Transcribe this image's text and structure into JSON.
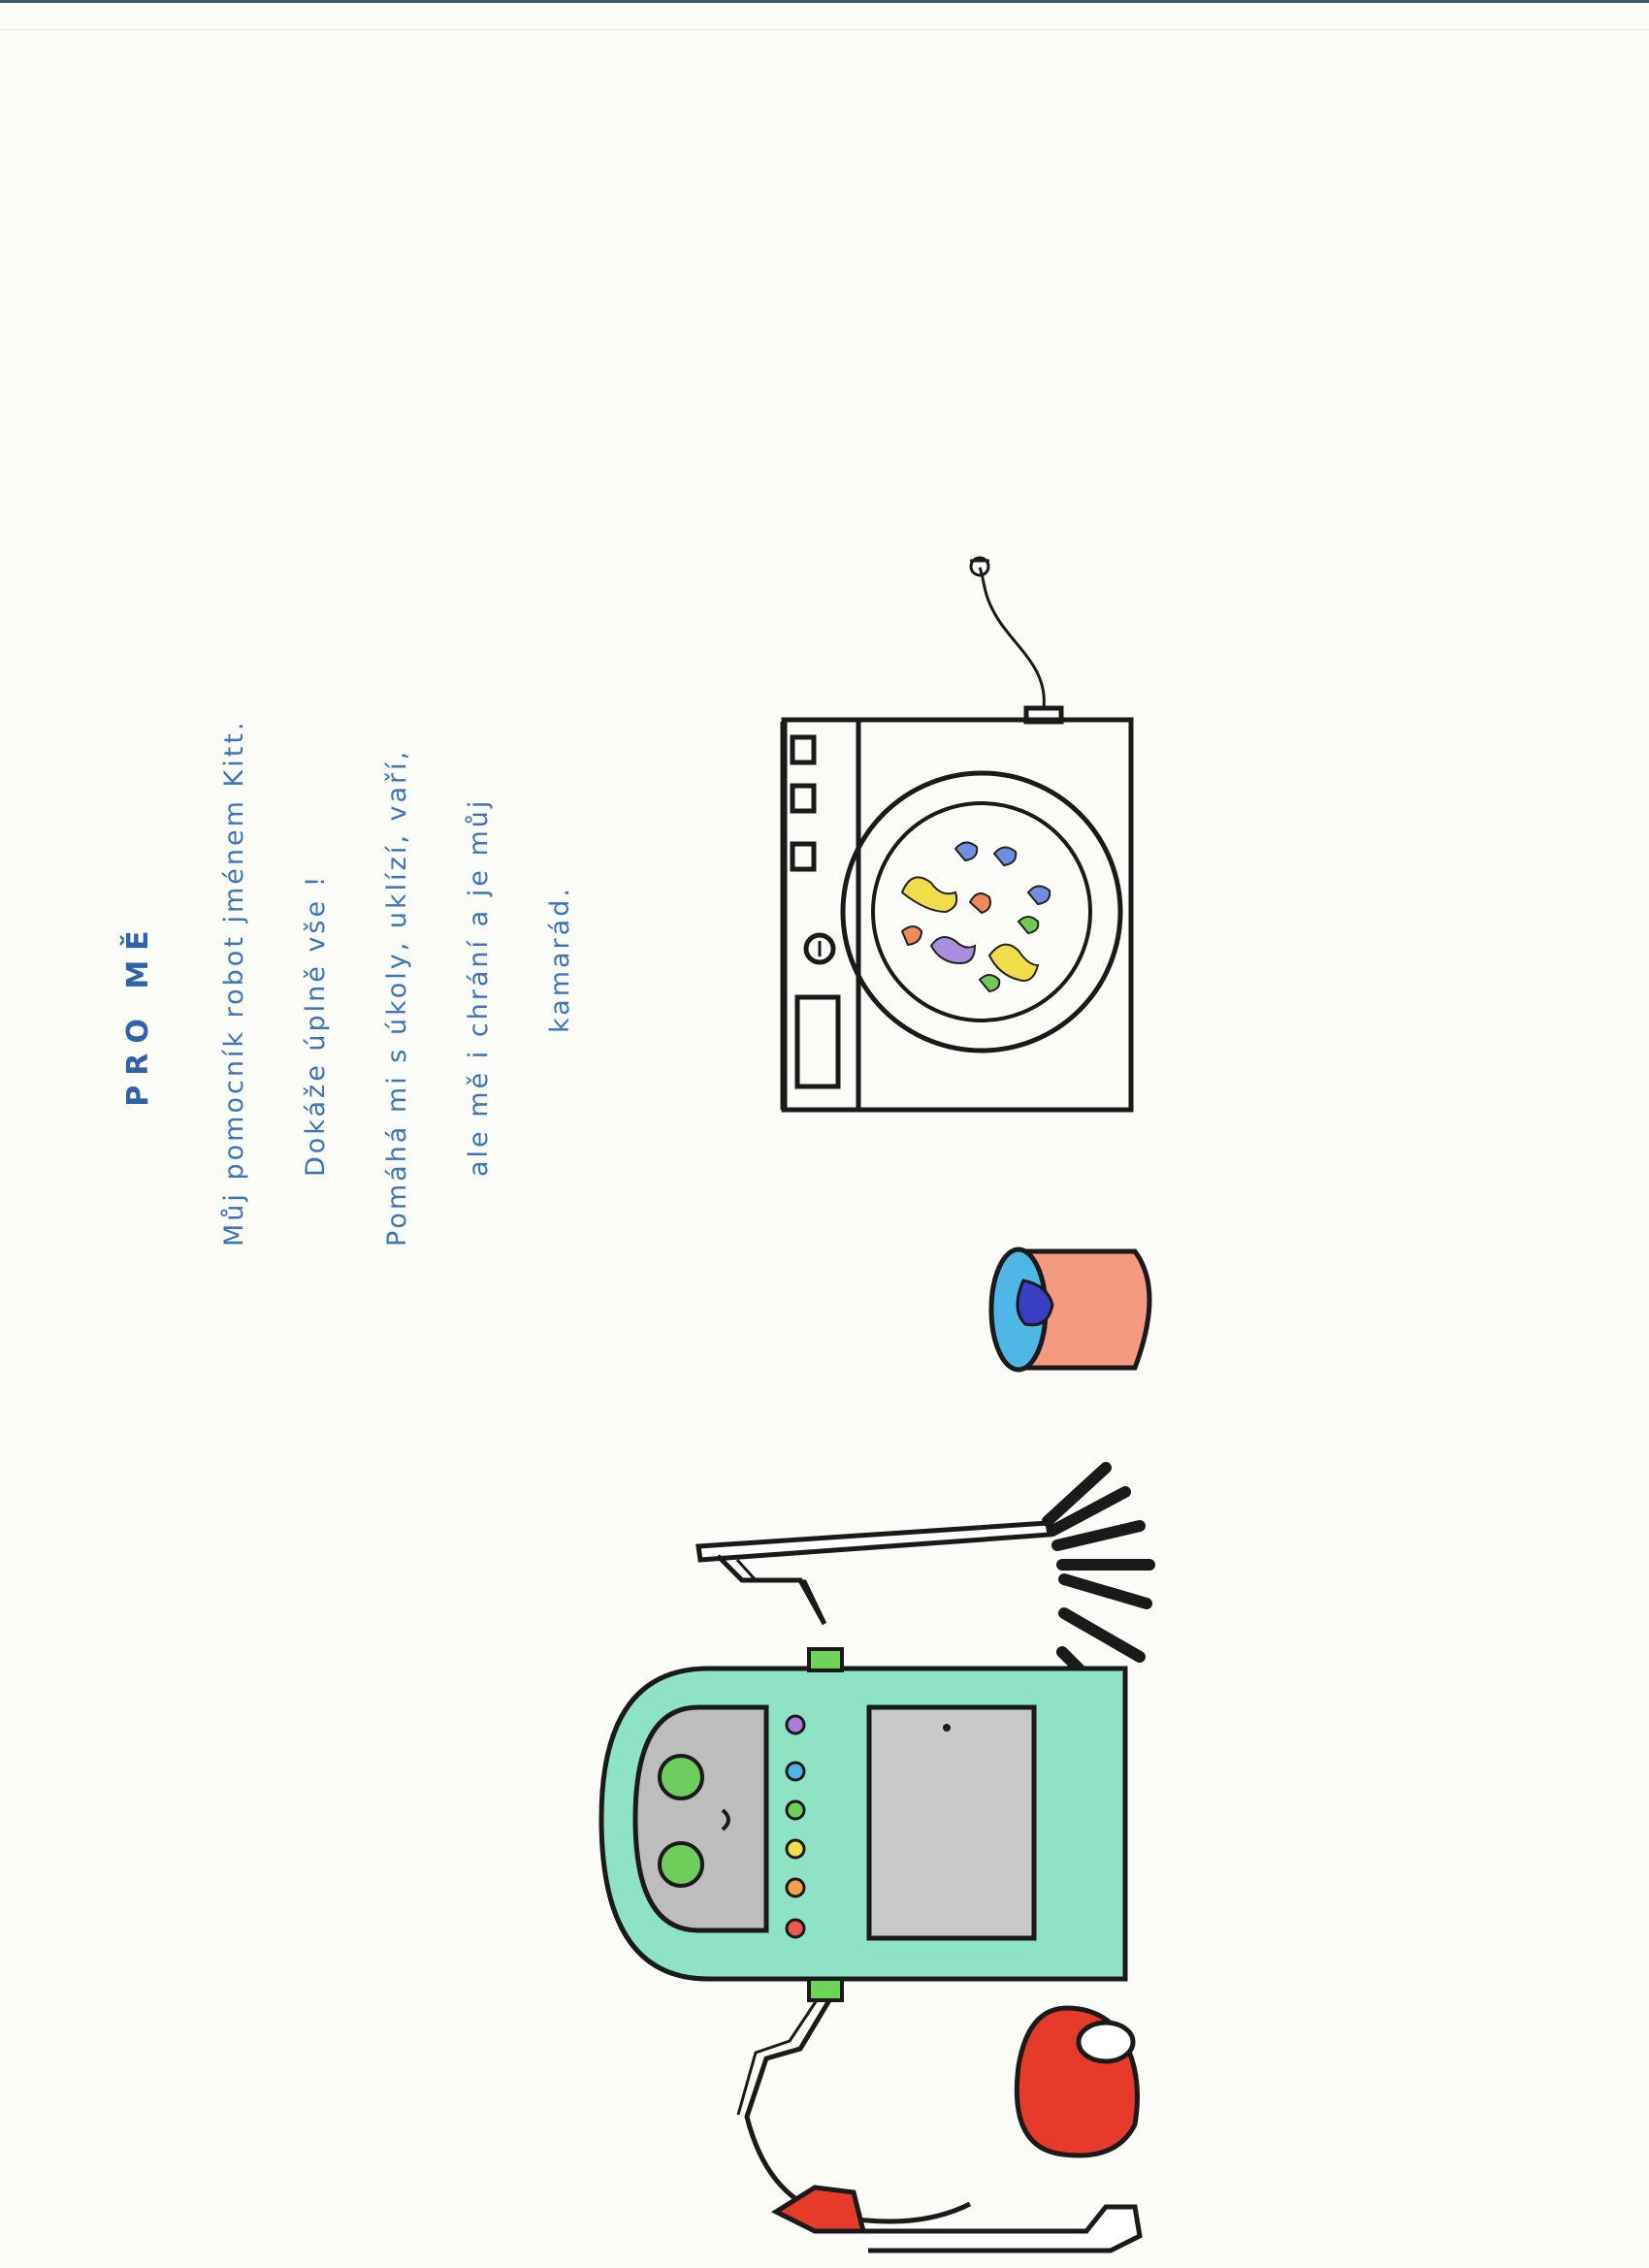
{
  "drawing": {
    "title": "PRO MĚ",
    "text_lines": [
      "Můj pomocník robot jménem Kitt.",
      "Dokáže úplně vše !",
      "Pomáhá mi s úkoly, uklízí, vaří,",
      "ale mě i chrání a je můj",
      "kamarád."
    ]
  }
}
